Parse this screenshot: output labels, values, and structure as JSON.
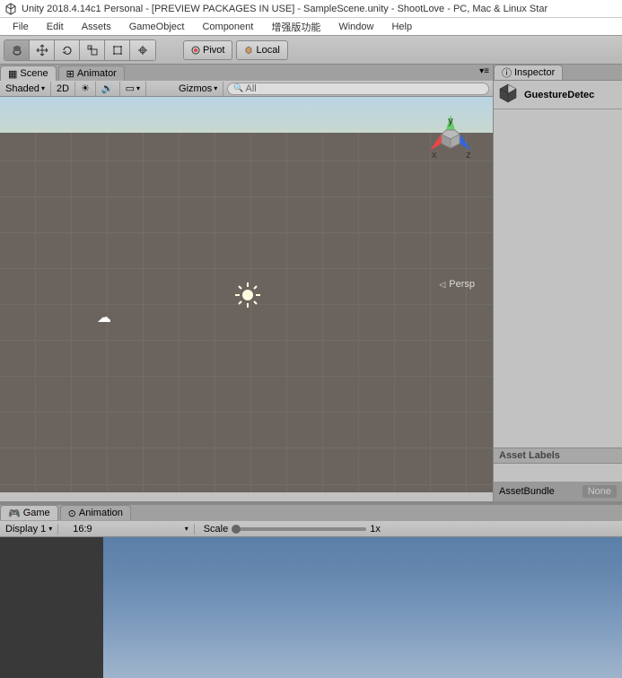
{
  "titlebar": {
    "text": "Unity 2018.4.14c1 Personal - [PREVIEW PACKAGES IN USE] - SampleScene.unity - ShootLove - PC, Mac & Linux Star"
  },
  "menu": {
    "items": [
      "File",
      "Edit",
      "Assets",
      "GameObject",
      "Component",
      "增强版功能",
      "Window",
      "Help"
    ]
  },
  "toolbar": {
    "pivot_label": "Pivot",
    "local_label": "Local"
  },
  "scene_tabs": {
    "scene": "Scene",
    "animator": "Animator"
  },
  "scene_toolbar": {
    "shaded": "Shaded",
    "mode_2d": "2D",
    "gizmos": "Gizmos",
    "search_placeholder": "All"
  },
  "scene_view": {
    "persp": "Persp"
  },
  "inspector": {
    "tab": "Inspector",
    "object_name": "GuestureDetec",
    "asset_labels": "Asset Labels",
    "asset_bundle": "AssetBundle",
    "asset_bundle_value": "None"
  },
  "bottom_tabs": {
    "game": "Game",
    "animation": "Animation"
  },
  "game_toolbar": {
    "display": "Display 1",
    "aspect": "16:9",
    "scale_label": "Scale",
    "scale_value": "1x"
  }
}
